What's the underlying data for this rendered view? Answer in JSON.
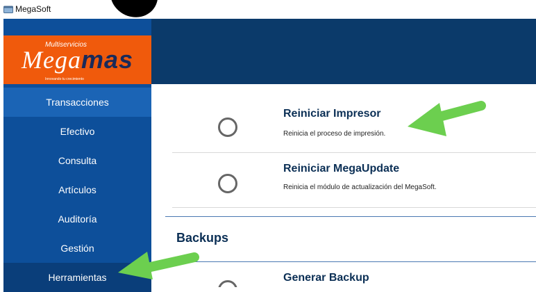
{
  "window": {
    "title": "MegaSoft"
  },
  "logo": {
    "line_small": "Multiservicios",
    "brand_first": "Mega",
    "brand_second": "mas",
    "tagline": "Innovando tu crecimiento"
  },
  "sidebar": {
    "items": [
      {
        "label": "Transacciones"
      },
      {
        "label": "Efectivo"
      },
      {
        "label": "Consulta"
      },
      {
        "label": "Artículos"
      },
      {
        "label": "Auditoría"
      },
      {
        "label": "Gestión"
      },
      {
        "label": "Herramientas"
      }
    ]
  },
  "tools": [
    {
      "title": "Reiniciar Impresor",
      "description": "Reinicia el proceso de impresión."
    },
    {
      "title": "Reiniciar MegaUpdate",
      "description": "Reinicia el módulo de actualización del MegaSoft."
    }
  ],
  "backups": {
    "heading": "Backups",
    "items": [
      {
        "title": "Generar Backup"
      }
    ]
  },
  "colors": {
    "sidebar": "#0d4f9a",
    "logo_band": "#f05a0c",
    "top_band": "#0b3a6a",
    "annotation_arrow": "#6ccf4f"
  },
  "icons": [
    "app-window-icon",
    "radio-circle-icon",
    "green-arrow-annotation"
  ]
}
